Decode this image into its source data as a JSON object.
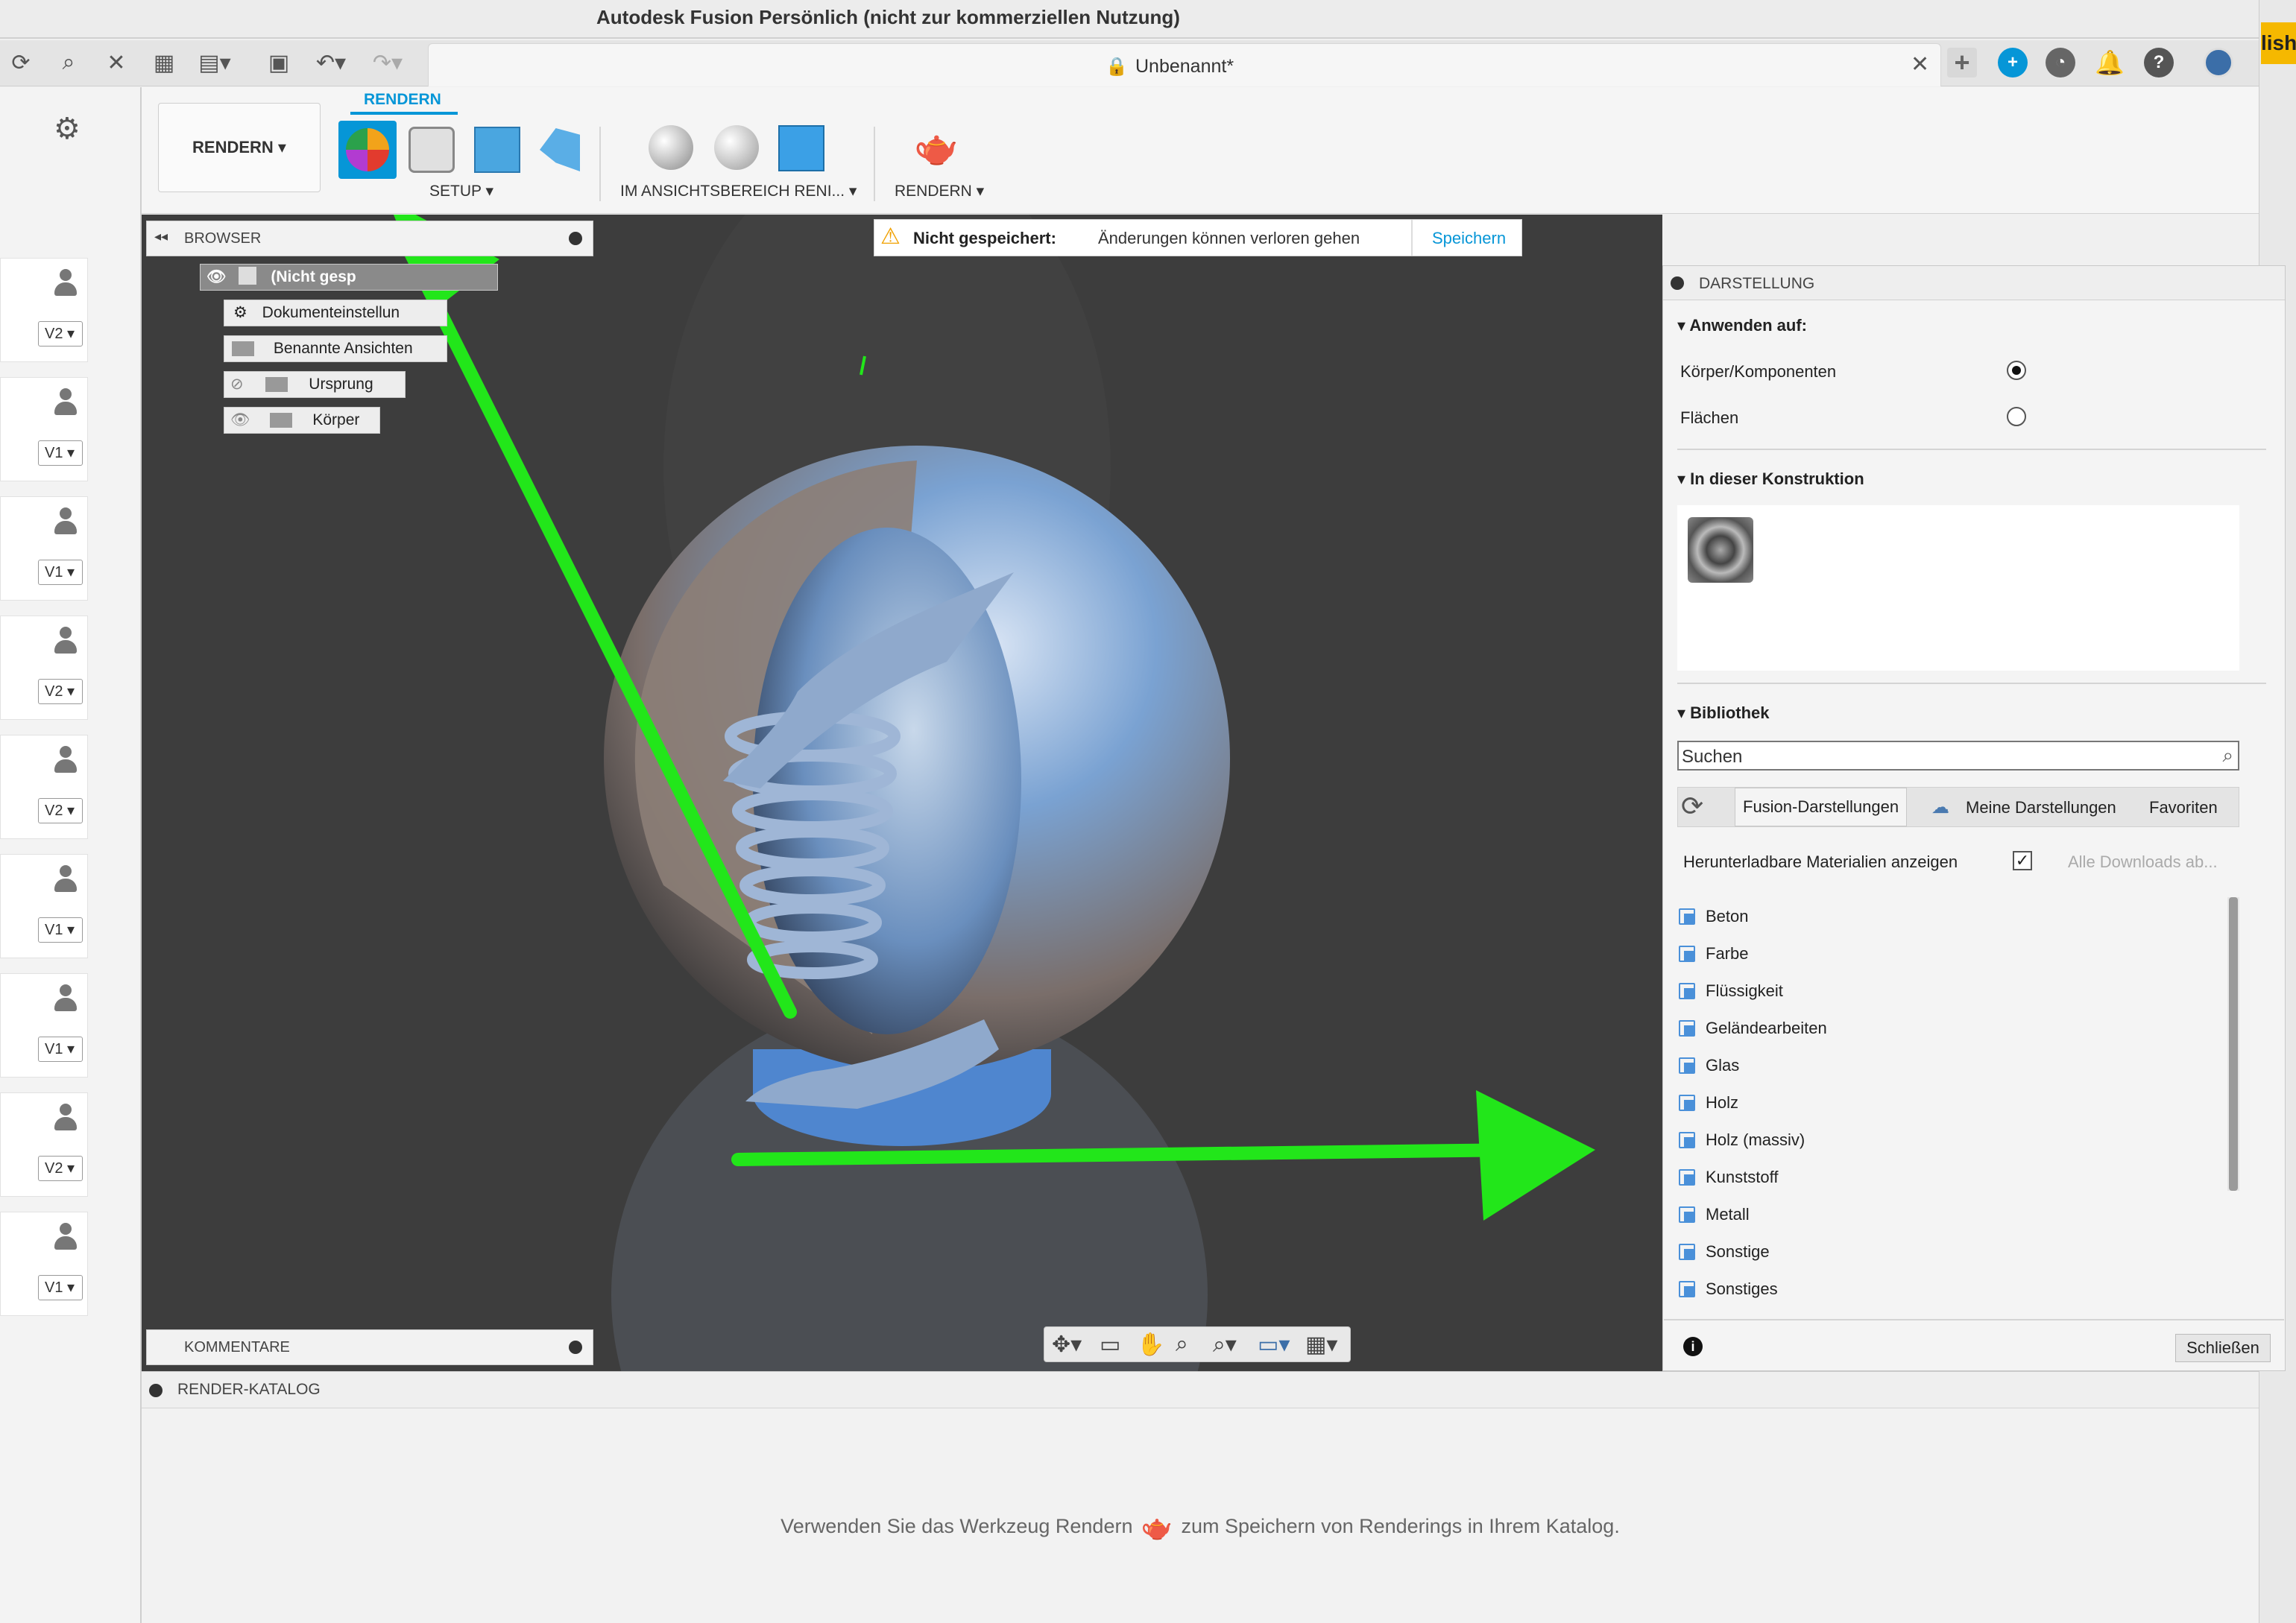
{
  "window": {
    "title": "Autodesk Fusion Persönlich (nicht zur kommerziellen Nutzung)",
    "right_clip": "lish"
  },
  "doc_tab": {
    "name": "Unbenannt*"
  },
  "versions": [
    "V2",
    "V1",
    "V1",
    "V2",
    "V2",
    "V1",
    "V1",
    "V2",
    "V1"
  ],
  "ribbon": {
    "mode": "RENDERN",
    "active_tab": "RENDERN",
    "setup_label": "SETUP",
    "viewport_render_label": "IM ANSICHTSBEREICH RENI...",
    "render_label": "RENDERN"
  },
  "browser": {
    "header": "BROWSER",
    "root": "(Nicht gesp",
    "items": [
      "Dokumenteinstellun",
      "Benannte Ansichten",
      "Ursprung",
      "Körper"
    ]
  },
  "save_notice": {
    "status": "Nicht gespeichert:",
    "message": "Änderungen können verloren gehen",
    "button": "Speichern"
  },
  "comments": {
    "header": "KOMMENTARE"
  },
  "darstellung": {
    "header": "DARSTELLUNG",
    "apply_to": "Anwenden auf:",
    "options": [
      {
        "label": "Körper/Komponenten",
        "selected": true
      },
      {
        "label": "Flächen",
        "selected": false
      }
    ],
    "in_design": "In dieser Konstruktion",
    "library": "Bibliothek",
    "search_placeholder": "Suchen",
    "tabs": [
      "Fusion-Darstellungen",
      "Meine Darstellungen",
      "Favoriten"
    ],
    "download_label": "Herunterladbare Materialien anzeigen",
    "download_all": "Alle Downloads ab...",
    "categories": [
      "Beton",
      "Farbe",
      "Flüssigkeit",
      "Geländearbeiten",
      "Glas",
      "Holz",
      "Holz (massiv)",
      "Kunststoff",
      "Metall",
      "Sonstige",
      "Sonstiges"
    ],
    "close": "Schließen"
  },
  "render_catalog": {
    "header": "RENDER-KATALOG",
    "msg_before": "Verwenden Sie das Werkzeug Rendern",
    "msg_after": "zum Speichern von Renderings in Ihrem Katalog."
  },
  "colors": {
    "accent": "#0696d7",
    "arrow": "#22e61a"
  }
}
